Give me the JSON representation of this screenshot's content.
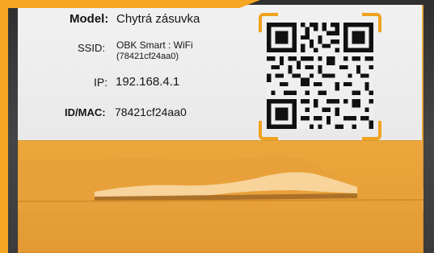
{
  "label": {
    "model_key": "Model:",
    "model_value": "Chytrá zásuvka",
    "ssid_key": "SSID:",
    "ssid_value": "OBK Smart : WiFi",
    "ssid_sub": "(78421cf24aa0)",
    "ip_key": "IP:",
    "ip_value": "192.168.4.1",
    "idmac_key": "ID/MAC:",
    "idmac_value": "78421cf24aa0"
  },
  "colors": {
    "accent": "#f5a623",
    "box": "#eba73c",
    "label": "#efefef"
  },
  "icons": {
    "qr": "qr-code"
  }
}
